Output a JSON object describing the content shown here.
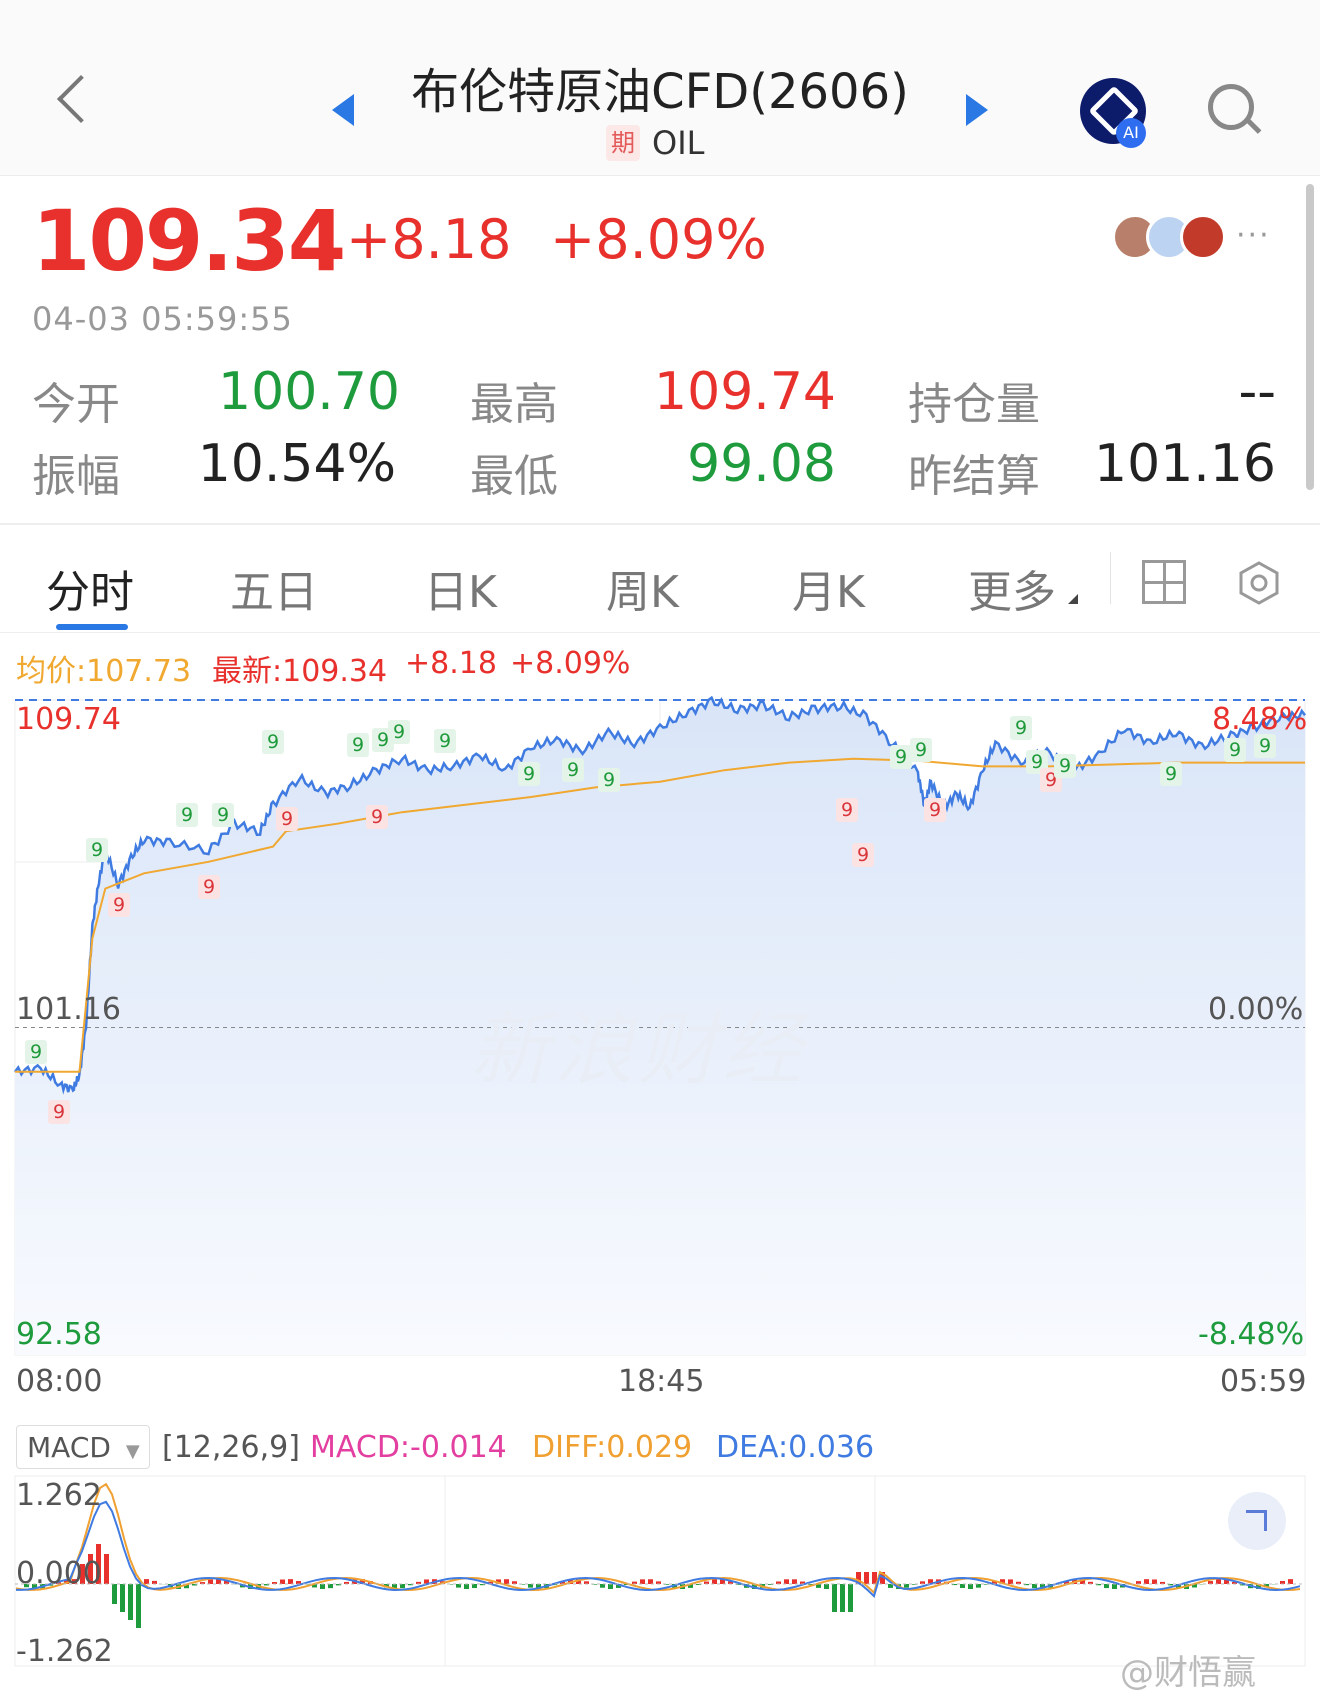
{
  "header": {
    "back_icon": "chevron-left-icon",
    "title": "布伦特原油CFD(2606)",
    "badge": "期",
    "code": "OIL",
    "ai_label": "AI"
  },
  "quote": {
    "price": "109.34",
    "change": "+8.18",
    "change_pct": "+8.09%",
    "time": "04-03 05:59:55",
    "more": "···",
    "stats": [
      {
        "label": "今开",
        "value": "100.70",
        "color": "#1e9b3c"
      },
      {
        "label": "最高",
        "value": "109.74",
        "color": "#e8312c"
      },
      {
        "label": "持仓量",
        "value": "--",
        "color": "#222222"
      },
      {
        "label": "振幅",
        "value": "10.54%",
        "color": "#222222"
      },
      {
        "label": "最低",
        "value": "99.08",
        "color": "#1e9b3c"
      },
      {
        "label": "昨结算",
        "value": "101.16",
        "color": "#222222"
      }
    ]
  },
  "tabs": [
    "分时",
    "五日",
    "日K",
    "周K",
    "月K",
    "更多"
  ],
  "legend": {
    "avg": "均价:107.73",
    "latest": "最新:109.34",
    "chg": "+8.18",
    "pct": "+8.09%"
  },
  "axis": {
    "y_high": "109.74",
    "y_mid": "101.16",
    "y_low": "92.58",
    "pct_high": "8.48%",
    "pct_mid": "0.00%",
    "pct_low": "-8.48%",
    "x_labels": [
      "08:00",
      "18:45",
      "05:59"
    ]
  },
  "watermark": "新浪财经",
  "chart_data": {
    "type": "line",
    "y_range": [
      92.58,
      109.74
    ],
    "reference_price": 101.16,
    "x_ticks": [
      "08:00",
      "18:45",
      "05:59"
    ],
    "series": [
      {
        "name": "最新",
        "color": "#3f7be0",
        "points": [
          [
            0,
            100.0
          ],
          [
            0.02,
            100.1
          ],
          [
            0.035,
            99.65
          ],
          [
            0.045,
            99.55
          ],
          [
            0.05,
            99.9
          ],
          [
            0.055,
            101.2
          ],
          [
            0.06,
            103.8
          ],
          [
            0.065,
            105.0
          ],
          [
            0.07,
            105.8
          ],
          [
            0.08,
            104.9
          ],
          [
            0.09,
            105.6
          ],
          [
            0.1,
            106.1
          ],
          [
            0.12,
            106.0
          ],
          [
            0.15,
            105.8
          ],
          [
            0.17,
            106.5
          ],
          [
            0.19,
            106.3
          ],
          [
            0.2,
            107.0
          ],
          [
            0.22,
            107.7
          ],
          [
            0.24,
            107.3
          ],
          [
            0.26,
            107.5
          ],
          [
            0.28,
            107.9
          ],
          [
            0.3,
            108.2
          ],
          [
            0.32,
            107.9
          ],
          [
            0.34,
            108.0
          ],
          [
            0.36,
            108.3
          ],
          [
            0.38,
            107.9
          ],
          [
            0.4,
            108.5
          ],
          [
            0.42,
            108.7
          ],
          [
            0.44,
            108.4
          ],
          [
            0.46,
            108.9
          ],
          [
            0.48,
            108.6
          ],
          [
            0.5,
            109.0
          ],
          [
            0.52,
            109.4
          ],
          [
            0.54,
            109.7
          ],
          [
            0.56,
            109.5
          ],
          [
            0.58,
            109.6
          ],
          [
            0.6,
            109.3
          ],
          [
            0.62,
            109.5
          ],
          [
            0.64,
            109.6
          ],
          [
            0.66,
            109.3
          ],
          [
            0.68,
            108.6
          ],
          [
            0.7,
            107.8
          ],
          [
            0.705,
            107.0
          ],
          [
            0.71,
            107.6
          ],
          [
            0.72,
            106.9
          ],
          [
            0.73,
            107.3
          ],
          [
            0.74,
            106.9
          ],
          [
            0.75,
            107.9
          ],
          [
            0.76,
            108.6
          ],
          [
            0.78,
            108.1
          ],
          [
            0.8,
            108.4
          ],
          [
            0.82,
            107.9
          ],
          [
            0.84,
            108.3
          ],
          [
            0.86,
            109.0
          ],
          [
            0.88,
            108.6
          ],
          [
            0.9,
            108.9
          ],
          [
            0.92,
            108.5
          ],
          [
            0.94,
            108.8
          ],
          [
            0.96,
            109.0
          ],
          [
            0.98,
            109.3
          ],
          [
            1.0,
            109.34
          ]
        ]
      },
      {
        "name": "均价",
        "color": "#f0a830",
        "points": [
          [
            0,
            100.0
          ],
          [
            0.05,
            100.0
          ],
          [
            0.06,
            103.5
          ],
          [
            0.07,
            104.8
          ],
          [
            0.1,
            105.2
          ],
          [
            0.15,
            105.5
          ],
          [
            0.2,
            105.9
          ],
          [
            0.21,
            106.3
          ],
          [
            0.25,
            106.5
          ],
          [
            0.3,
            106.8
          ],
          [
            0.35,
            107.0
          ],
          [
            0.4,
            107.2
          ],
          [
            0.45,
            107.45
          ],
          [
            0.5,
            107.6
          ],
          [
            0.55,
            107.9
          ],
          [
            0.6,
            108.1
          ],
          [
            0.65,
            108.2
          ],
          [
            0.7,
            108.15
          ],
          [
            0.75,
            108.0
          ],
          [
            0.8,
            108.0
          ],
          [
            0.85,
            108.05
          ],
          [
            0.9,
            108.1
          ],
          [
            0.95,
            108.1
          ],
          [
            1.0,
            108.1
          ]
        ]
      }
    ]
  },
  "macd": {
    "indicator": "MACD",
    "params": "[12,26,9]",
    "macd": "MACD:-0.014",
    "diff": "DIFF:0.029",
    "dea": "DEA:0.036",
    "y_high": "1.262",
    "y_mid": "0.000",
    "y_low": "-1.262",
    "colors": {
      "macd": "#e33fa0",
      "diff": "#f0a030",
      "dea": "#3f7be0"
    }
  },
  "footer": {
    "weibo": "@财悟赢"
  }
}
